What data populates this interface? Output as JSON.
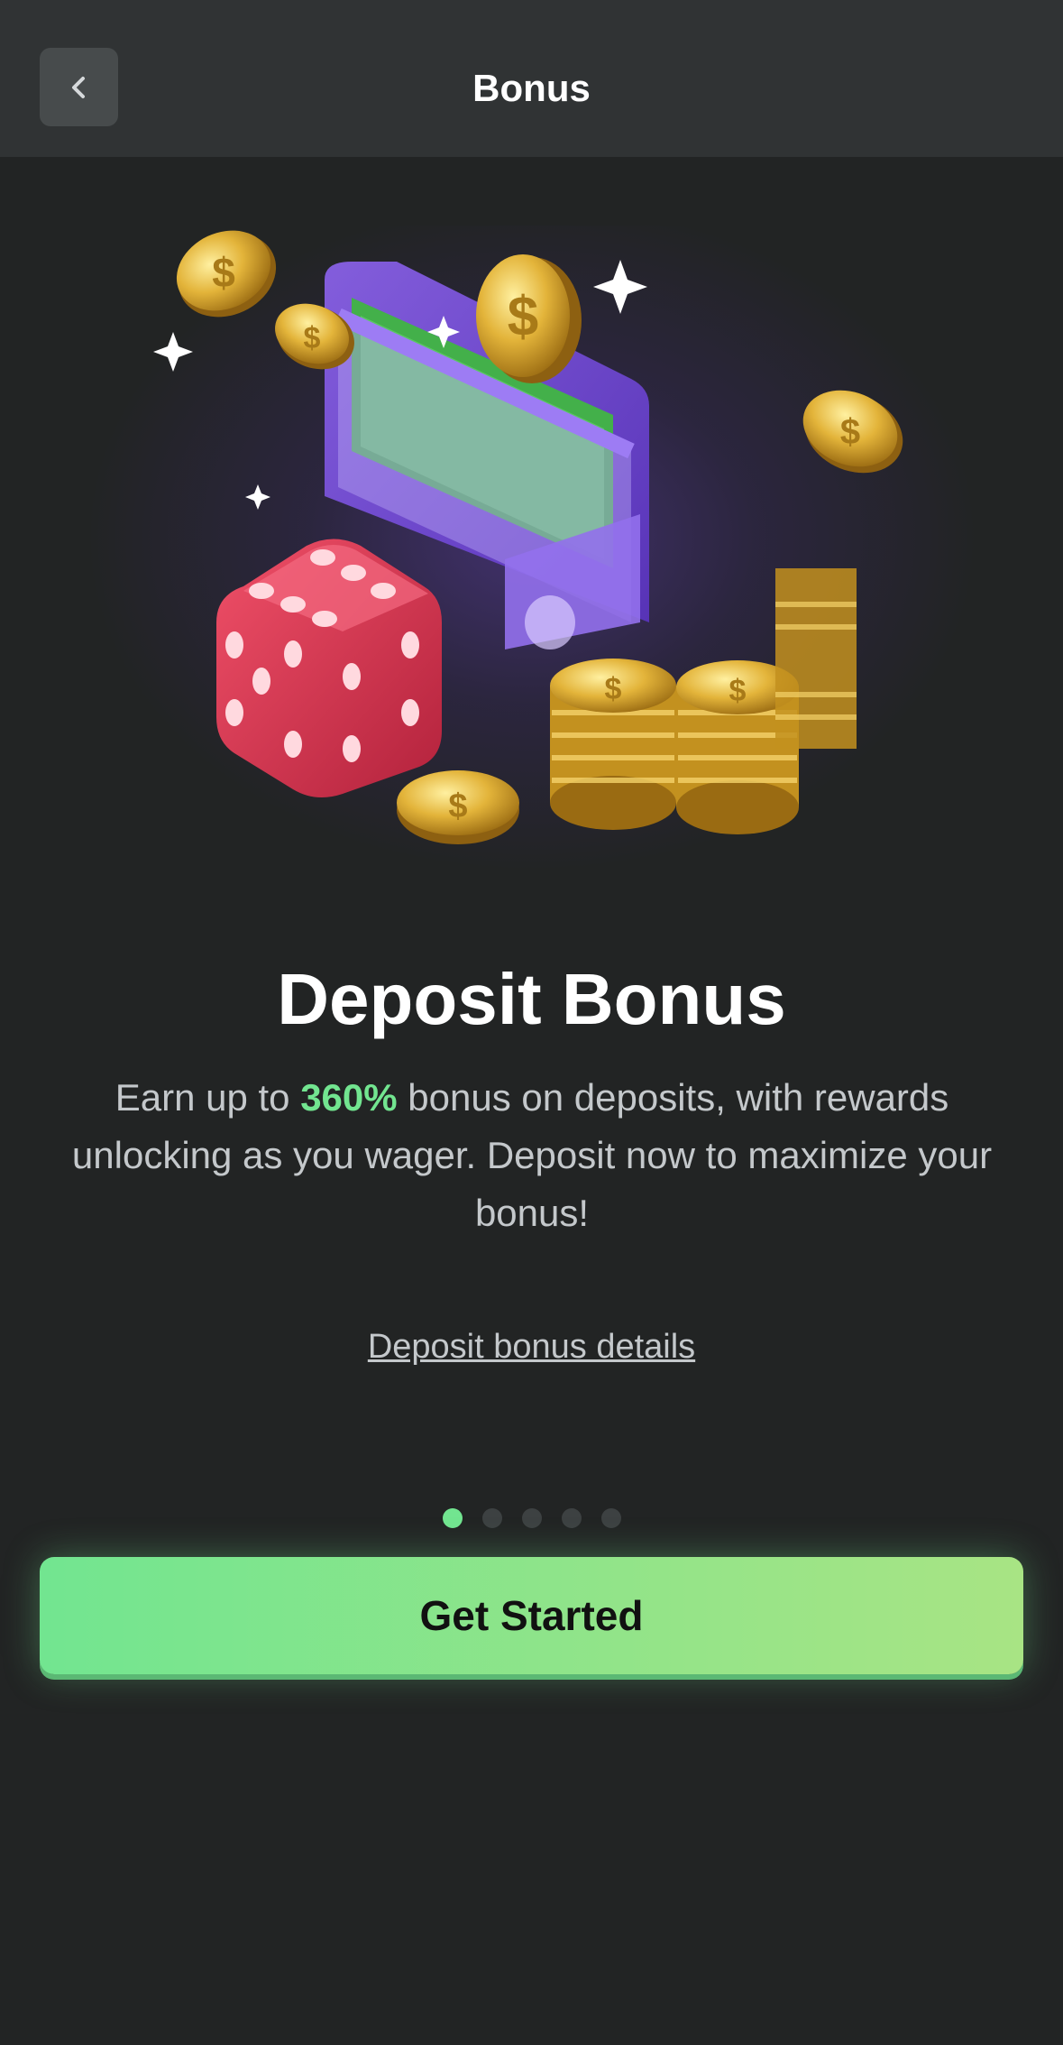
{
  "header": {
    "title": "Bonus",
    "back_icon": "chevron-left-icon"
  },
  "hero": {
    "illustration": "wallet-coins-dice-illustration",
    "colors": {
      "wallet": "#7a4fe0",
      "coin": "#d9a82c",
      "dice": "#d8384f",
      "cash": "#4caf50"
    }
  },
  "main": {
    "title": "Deposit Bonus",
    "description_prefix": "Earn up to ",
    "description_highlight": "360%",
    "description_suffix": " bonus on deposits, with rewards unlocking as you wager. Deposit now to maximize your bonus!",
    "details_link": "Deposit bonus details"
  },
  "pagination": {
    "total": 5,
    "active_index": 0
  },
  "cta": {
    "label": "Get Started"
  },
  "colors": {
    "accent": "#72e590",
    "background": "#222424",
    "header": "#303334"
  }
}
